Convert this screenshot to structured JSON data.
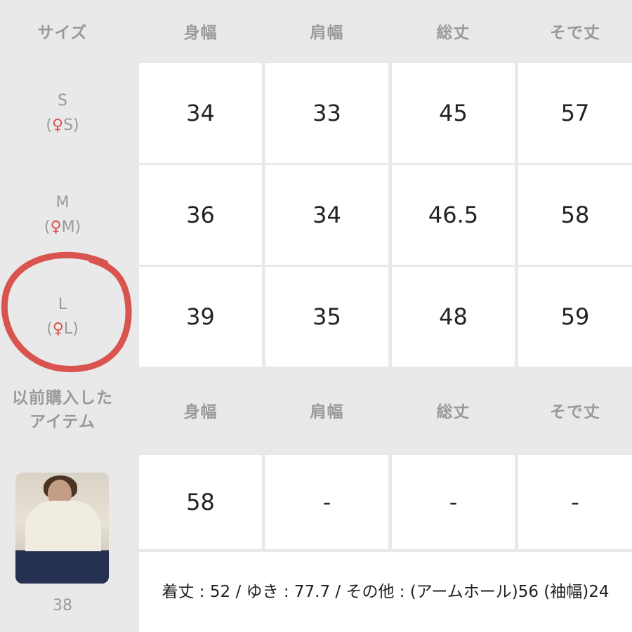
{
  "header1": {
    "size": "サイズ",
    "cols": [
      "身幅",
      "肩幅",
      "総丈",
      "そで丈"
    ]
  },
  "rows": [
    {
      "size": "S",
      "sub": "S",
      "values": [
        "34",
        "33",
        "45",
        "57"
      ]
    },
    {
      "size": "M",
      "sub": "M",
      "values": [
        "36",
        "34",
        "46.5",
        "58"
      ]
    },
    {
      "size": "L",
      "sub": "L",
      "values": [
        "39",
        "35",
        "48",
        "59"
      ]
    }
  ],
  "header2": {
    "label_line1": "以前購入した",
    "label_line2": "アイテム",
    "cols": [
      "身幅",
      "肩幅",
      "総丈",
      "そで丈"
    ]
  },
  "item": {
    "photo_label": "38",
    "values": [
      "58",
      "-",
      "-",
      "-"
    ],
    "note": "着丈 : 52 / ゆき : 77.7 / その他 : (アームホール)56 (袖幅)24"
  },
  "colors": {
    "annotation_circle": "#d9534f",
    "woman_icon": "#d9534f"
  },
  "icons": {
    "size_marker": "woman-icon"
  }
}
